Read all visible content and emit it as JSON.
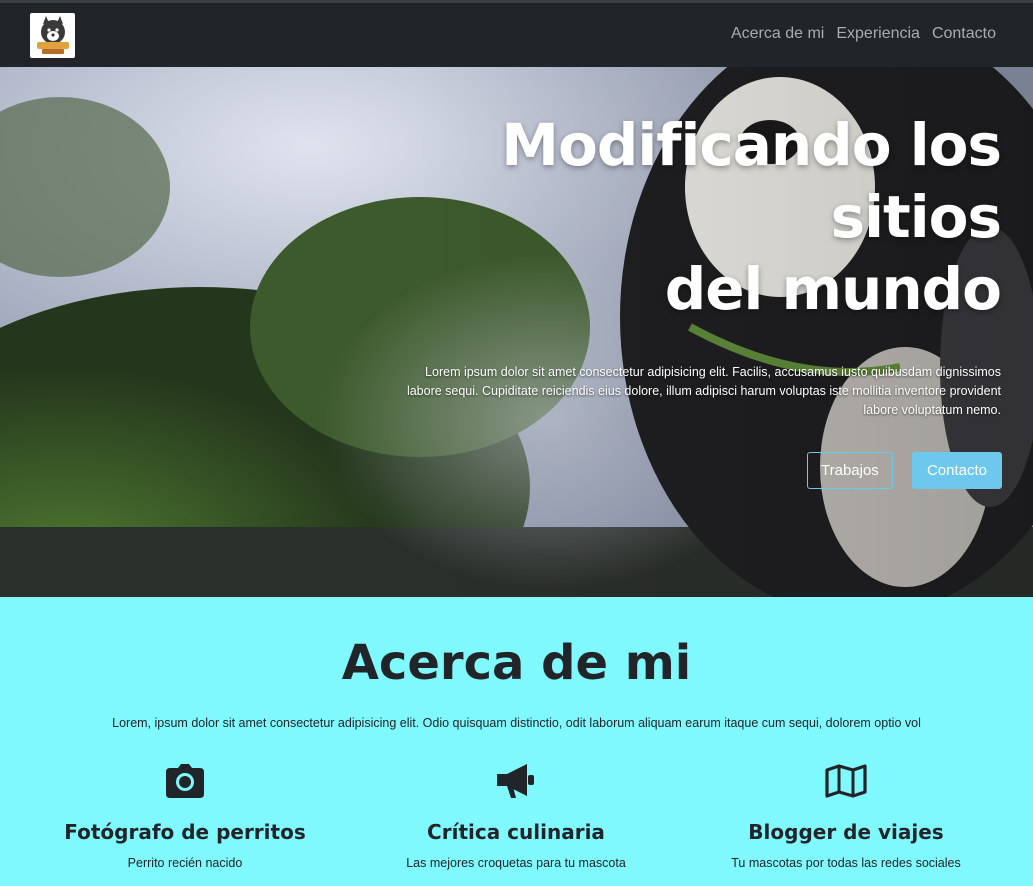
{
  "nav": {
    "logo_icon": "dog-logo-icon",
    "links": [
      "Acerca de mi",
      "Experiencia",
      "Contacto"
    ]
  },
  "hero": {
    "title_line1": "Modificando los",
    "title_line2": "sitios",
    "title_line3": "del mundo",
    "text": "Lorem ipsum dolor sit amet consectetur adipisicing elit. Facilis, accusamus iusto quibusdam dignissimos labore sequi. Cupiditate reiciendis eius dolore, illum adipisci harum voluptas iste mollitia inventore provident labore voluptatum nemo.",
    "button_works": "Trabajos",
    "button_contact": "Contacto"
  },
  "about": {
    "title": "Acerca de mi",
    "text": "Lorem, ipsum dolor sit amet consectetur adipisicing elit. Odio quisquam distinctio, odit laborum aliquam earum itaque cum sequi, dolorem optio vol",
    "features": [
      {
        "icon": "camera-icon",
        "title": "Fotógrafo de perritos",
        "desc": "Perrito recién nacido"
      },
      {
        "icon": "megaphone-icon",
        "title": "Crítica culinaria",
        "desc": "Las mejores croquetas para tu mascota"
      },
      {
        "icon": "map-icon",
        "title": "Blogger de viajes",
        "desc": "Tu mascotas por todas las redes sociales"
      }
    ]
  },
  "colors": {
    "navbar_bg": "#212529",
    "accent": "#6ec7ec",
    "about_bg": "#7ff9fd"
  }
}
